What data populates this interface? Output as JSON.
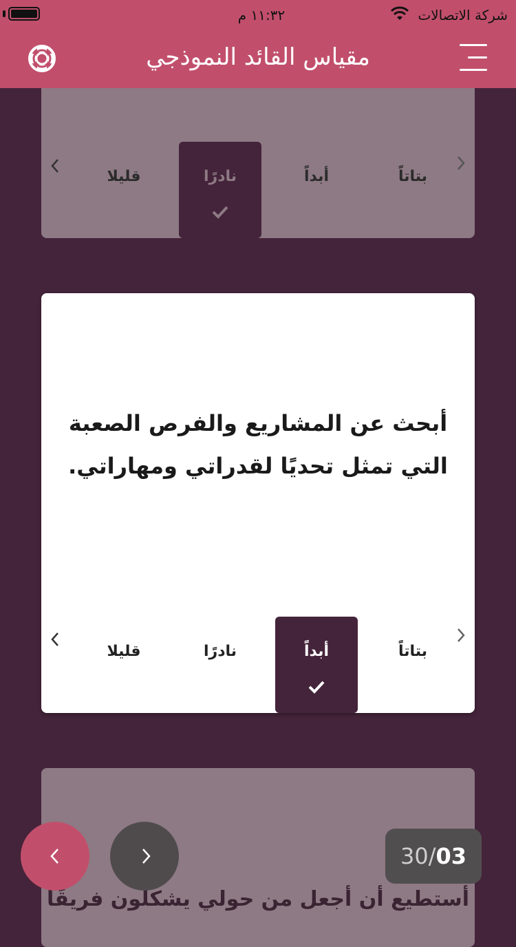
{
  "status_bar": {
    "carrier": "شركة الاتصالات",
    "time": "١١:٣٢ م"
  },
  "header": {
    "title": "مقياس القائد النموذجي",
    "left_icon": "lifebuoy-icon",
    "right_icon": "menu-icon",
    "background": "#c14f6c"
  },
  "cards": {
    "previous": {
      "options": [
        "بتاتاً",
        "أبداً",
        "نادرًا",
        "قليلا"
      ],
      "selected": "نادرًا"
    },
    "current": {
      "question": "أبحث عن المشاريع والفرص الصعبة التي تمثل تحديًا لقدراتي ومهاراتي.",
      "options": [
        "بتاتاً",
        "أبداً",
        "نادرًا",
        "قليلا"
      ],
      "selected": "أبداً"
    },
    "next": {
      "question": "أستطيع أن أجعل من حولي يشكلون فريقًا"
    }
  },
  "navigation": {
    "back_icon": "chevron-left-icon",
    "forward_icon": "chevron-right-icon",
    "counter_total": "30/",
    "counter_current": "03"
  },
  "colors": {
    "background": "#44243a",
    "accent": "#c14f6c",
    "inactive_card": "#8e7a84",
    "selected_option": "#44243a"
  }
}
